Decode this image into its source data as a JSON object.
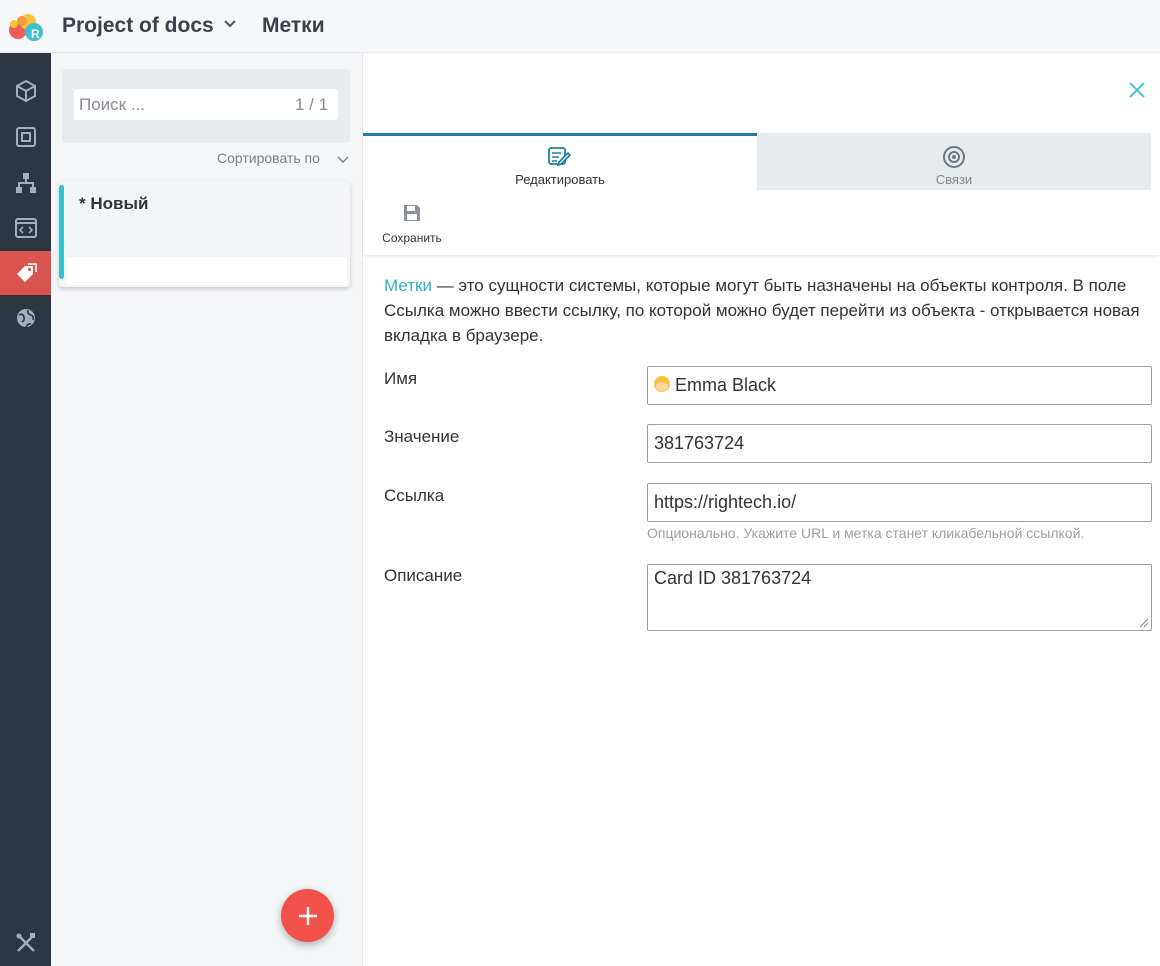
{
  "header": {
    "project_name": "Project of docs",
    "page_title": "Метки"
  },
  "nav": {
    "items": [
      {
        "icon": "cube-icon"
      },
      {
        "icon": "frame-icon"
      },
      {
        "icon": "hierarchy-icon"
      },
      {
        "icon": "code-window-icon"
      },
      {
        "icon": "tag-icon",
        "active": true
      },
      {
        "icon": "globe-icon"
      }
    ],
    "bottom_icon": "tools-icon",
    "active_color": "#d9534f"
  },
  "list": {
    "search_placeholder": "Поиск ...",
    "search_count": "1 / 1",
    "sort_label": "Сортировать по",
    "items": [
      {
        "title": "* Новый"
      }
    ],
    "accent_color": "#37c0c9",
    "add_button_icon": "plus-icon"
  },
  "detail": {
    "tabs": [
      {
        "label": "Редактировать",
        "icon": "edit-icon",
        "active": true
      },
      {
        "label": "Связи",
        "icon": "target-icon",
        "active": false
      }
    ],
    "toolbar": {
      "save_label": "Сохранить"
    },
    "description": {
      "link_text": "Метки",
      "text": " — это сущности системы, которые могут быть назначены на объекты контроля. В поле Ссылка можно ввести ссылку, по которой можно будет перейти из объекта - открывается новая вкладка в браузере."
    },
    "form": {
      "name_label": "Имя",
      "name_value": "Emma Black",
      "value_label": "Значение",
      "value_value": "381763724",
      "link_label": "Ссылка",
      "link_value": "https://rightech.io/",
      "link_hint": "Опционально. Укажите URL и метка станет кликабельной ссылкой.",
      "description_label": "Описание",
      "description_value": "Card ID 381763724"
    },
    "accent_color": "#1f7fa0"
  }
}
